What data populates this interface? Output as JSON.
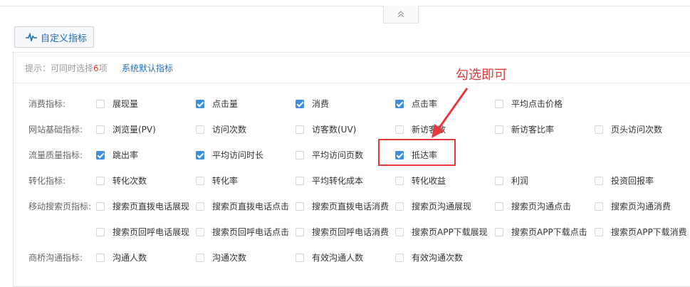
{
  "toolbar": {
    "custom_metrics_label": "自定义指标"
  },
  "hint": {
    "prefix": "提示：可同时选择",
    "count": "6",
    "suffix": "项",
    "default_link": "系统默认指标"
  },
  "annotation": "勾选即可",
  "rows": [
    {
      "label": "消费指标:",
      "options": [
        {
          "text": "展现量",
          "checked": false
        },
        {
          "text": "点击量",
          "checked": true
        },
        {
          "text": "消费",
          "checked": true
        },
        {
          "text": "点击率",
          "checked": true
        },
        {
          "text": "平均点击价格",
          "checked": false
        }
      ]
    },
    {
      "label": "网站基础指标:",
      "options": [
        {
          "text": "浏览量(PV)",
          "checked": false
        },
        {
          "text": "访问次数",
          "checked": false
        },
        {
          "text": "访客数(UV)",
          "checked": false
        },
        {
          "text": "新访客数",
          "checked": false
        },
        {
          "text": "新访客比率",
          "checked": false
        },
        {
          "text": "页头访问次数",
          "checked": false
        }
      ]
    },
    {
      "label": "流量质量指标:",
      "options": [
        {
          "text": "跳出率",
          "checked": true
        },
        {
          "text": "平均访问时长",
          "checked": true
        },
        {
          "text": "平均访问页数",
          "checked": false
        },
        {
          "text": "抵达率",
          "checked": true
        }
      ]
    },
    {
      "label": "转化指标:",
      "options": [
        {
          "text": "转化次数",
          "checked": false
        },
        {
          "text": "转化率",
          "checked": false
        },
        {
          "text": "平均转化成本",
          "checked": false
        },
        {
          "text": "转化收益",
          "checked": false
        },
        {
          "text": "利润",
          "checked": false
        },
        {
          "text": "投资回报率",
          "checked": false
        }
      ]
    },
    {
      "label": "移动搜索页指标:",
      "options": [
        {
          "text": "搜索页直拨电话展现",
          "checked": false
        },
        {
          "text": "搜索页直拨电话点击",
          "checked": false
        },
        {
          "text": "搜索页直拨电话消费",
          "checked": false
        },
        {
          "text": "搜索页沟通展现",
          "checked": false
        },
        {
          "text": "搜索页沟通点击",
          "checked": false
        },
        {
          "text": "搜索页沟通消费",
          "checked": false
        }
      ]
    },
    {
      "label": "",
      "options": [
        {
          "text": "搜索页回呼电话展现",
          "checked": false
        },
        {
          "text": "搜索页回呼电话点击",
          "checked": false
        },
        {
          "text": "搜索页回呼电话消费",
          "checked": false
        },
        {
          "text": "搜索页APP下载展现",
          "checked": false
        },
        {
          "text": "搜索页APP下载点击",
          "checked": false
        },
        {
          "text": "搜索页APP下载消费",
          "checked": false
        }
      ]
    },
    {
      "label": "商桥沟通指标:",
      "options": [
        {
          "text": "沟通人数",
          "checked": false
        },
        {
          "text": "沟通次数",
          "checked": false
        },
        {
          "text": "有效沟通人数",
          "checked": false
        },
        {
          "text": "有效沟通次数",
          "checked": false
        }
      ]
    }
  ],
  "colors": {
    "accent": "#3e8ee0",
    "highlight": "#e4393c",
    "link": "#1f6fbf"
  },
  "icons": {
    "collapse": "chevron-up-double-icon",
    "metrics": "pulse-icon"
  }
}
